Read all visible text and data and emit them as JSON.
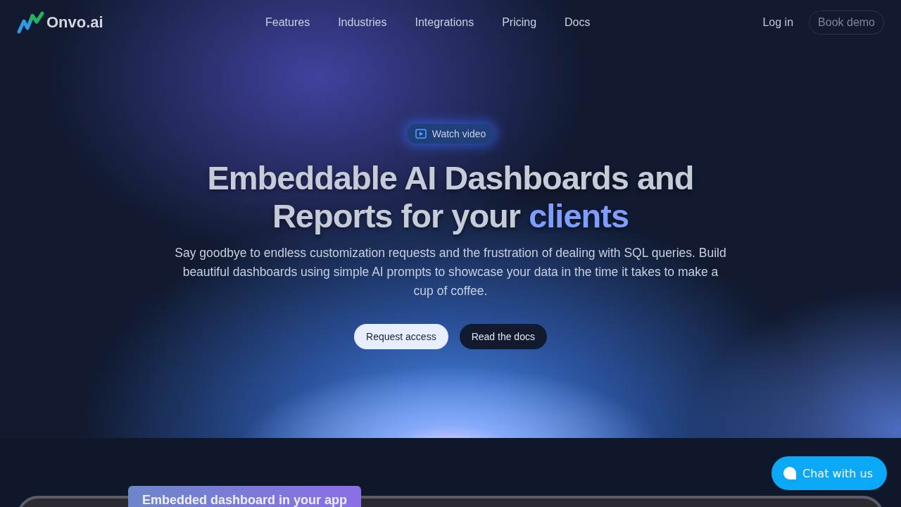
{
  "brand": {
    "name": "Onvo.ai"
  },
  "nav": {
    "links": [
      "Features",
      "Industries",
      "Integrations",
      "Pricing",
      "Docs"
    ],
    "login": "Log in",
    "cta": "Book demo"
  },
  "hero": {
    "badge": "Watch video",
    "title": "Embeddable AI Dashboards and Reports for your",
    "highlight": "clients",
    "subtitle": "Say goodbye to endless customization requests and the frustration of dealing with SQL queries. Build beautiful dashboards using simple AI prompts to showcase your data in the time it takes to make a cup of coffee.",
    "buttons": [
      {
        "label": "Request access",
        "kind": "primary"
      },
      {
        "label": "Read the docs",
        "kind": "secondary"
      }
    ]
  },
  "preview": {
    "tab": "Embedded dashboard in your app"
  },
  "chat": {
    "label": "Chat with us"
  }
}
